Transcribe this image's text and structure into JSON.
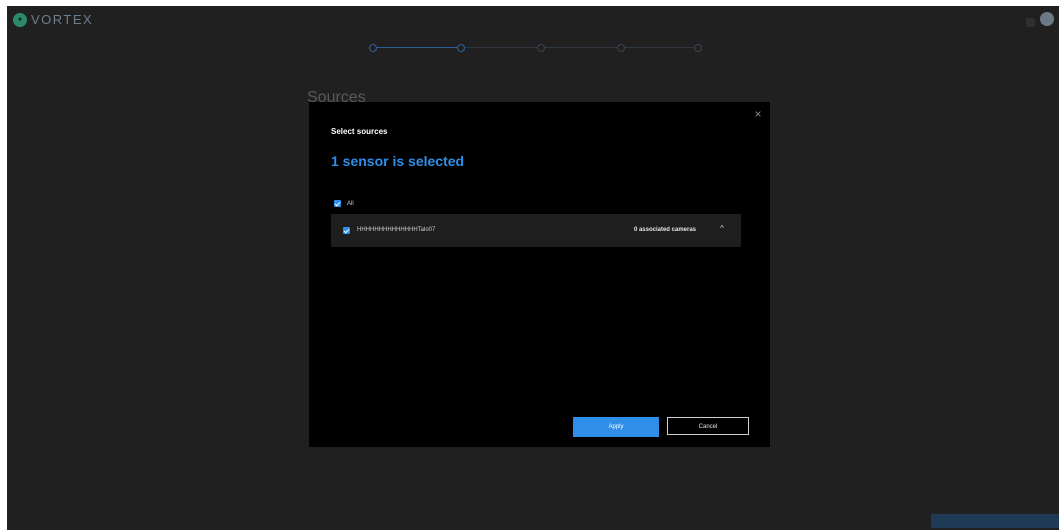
{
  "app": {
    "brand": "VORTEX"
  },
  "stepper": {
    "steps": [
      "",
      "",
      "",
      "",
      ""
    ],
    "labels": [
      "",
      "",
      ""
    ]
  },
  "page": {
    "title": "Sources"
  },
  "footer": {
    "previous_label": "",
    "next_label": ""
  },
  "modal": {
    "title": "Select sources",
    "heading": "1 sensor is selected",
    "all_label": "All",
    "sensors": [
      {
        "name": "HHHHHHHHHHHHHHTalo07",
        "cameras": "0 associated cameras",
        "checked": true
      }
    ],
    "apply_label": "Apply",
    "cancel_label": "Cancel",
    "close_glyph": "×",
    "expand_glyph": "^"
  },
  "colors": {
    "accent": "#2f8ee8",
    "modal_bg": "#000000",
    "backdrop": "#202020",
    "row_bg": "#1e1e1e"
  },
  "icons": {
    "logo": "vortex-logo-icon",
    "close": "close-icon",
    "expand": "chevron-up-icon",
    "avatar": "user-avatar-icon"
  }
}
